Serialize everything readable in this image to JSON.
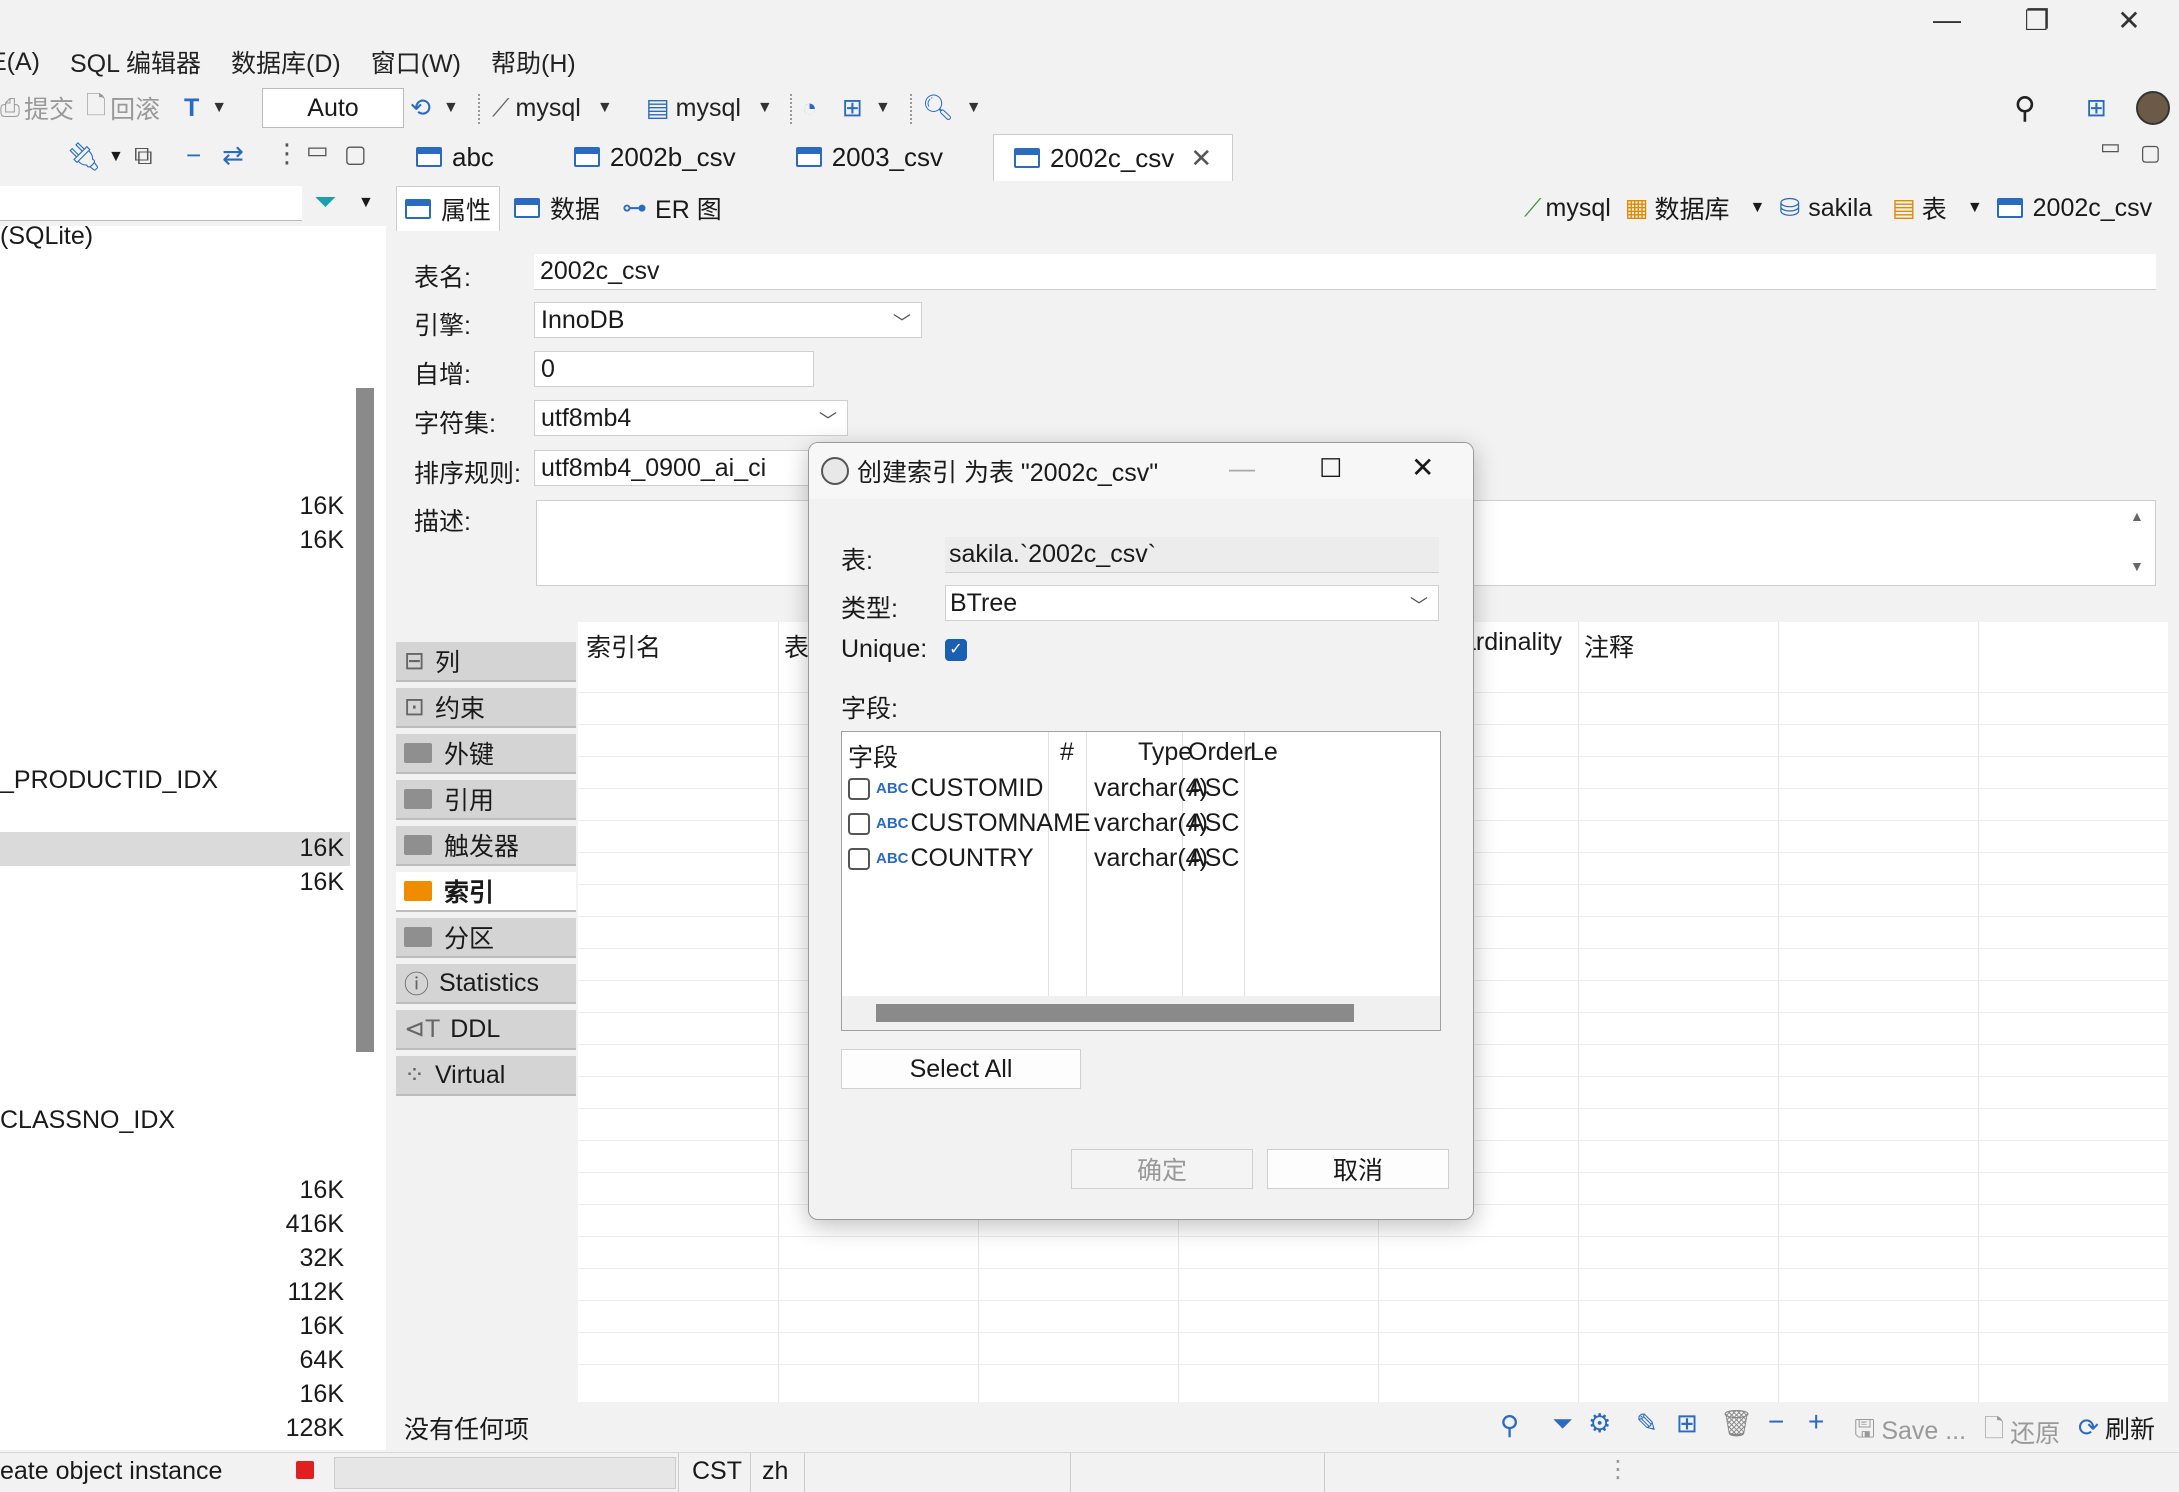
{
  "window": {
    "minimize": "—",
    "restore": "❐",
    "close": "✕"
  },
  "menu": [
    "E(A)",
    "SQL 编辑器",
    "数据库(D)",
    "窗口(W)",
    "帮助(H)"
  ],
  "toolbar": {
    "commit": "提交",
    "rollback": "回滚",
    "mode": "Auto",
    "datasource": "mysql",
    "schema": "mysql"
  },
  "left": {
    "rows": [
      {
        "text": "(SQLite)",
        "top": 0
      },
      {
        "text": "_PRODUCTID_IDX"
      },
      {
        "text": "CLASSNO_IDX"
      }
    ],
    "sizes_a": [
      "16K",
      "16K"
    ],
    "sizes_b": [
      "16K",
      "16K"
    ],
    "sizes_c": [
      "16K",
      "416K",
      "32K",
      "112K",
      "16K",
      "64K",
      "16K",
      "128K"
    ]
  },
  "editor_tabs": [
    "abc",
    "2002b_csv",
    "2003_csv",
    "2002c_csv"
  ],
  "sub_tabs": [
    "属性",
    "数据",
    "ER 图"
  ],
  "breadcrumb": [
    "mysql",
    "数据库",
    "sakila",
    "表",
    "2002c_csv"
  ],
  "form": {
    "table_name_label": "表名:",
    "table_name": "2002c_csv",
    "engine_label": "引擎:",
    "engine": "InnoDB",
    "auto_inc_label": "自增:",
    "auto_inc": "0",
    "charset_label": "字符集:",
    "charset": "utf8mb4",
    "collation_label": "排序规则:",
    "collation": "utf8mb4_0900_ai_ci",
    "desc_label": "描述:"
  },
  "side_nav": [
    "列",
    "约束",
    "外键",
    "引用",
    "触发器",
    "索引",
    "分区",
    "Statistics",
    "DDL",
    "Virtual"
  ],
  "grid_headers": {
    "index_name": "索引名",
    "table": "表",
    "cardinality": "ardinality",
    "comment": "注释"
  },
  "grid_footer": {
    "empty": "没有任何项",
    "save": "Save ...",
    "revert": "还原",
    "refresh": "刷新"
  },
  "status": {
    "msg": "eate object instance",
    "tz": "CST",
    "lang": "zh"
  },
  "dialog": {
    "title": "创建索引 为表 \"2002c_csv\"",
    "table_label": "表:",
    "table_value": "sakila.`2002c_csv`",
    "type_label": "类型:",
    "type_value": "BTree",
    "unique_label": "Unique:",
    "fields_label": "字段:",
    "columns": [
      "字段",
      "#",
      "Type",
      "Order",
      "Le"
    ],
    "fields": [
      {
        "name": "CUSTOMID",
        "type": "varchar(4)",
        "order": "ASC"
      },
      {
        "name": "CUSTOMNAME",
        "type": "varchar(4)",
        "order": "ASC"
      },
      {
        "name": "COUNTRY",
        "type": "varchar(4)",
        "order": "ASC"
      }
    ],
    "abc": "ABC",
    "select_all": "Select All",
    "ok": "确定",
    "cancel": "取消"
  }
}
